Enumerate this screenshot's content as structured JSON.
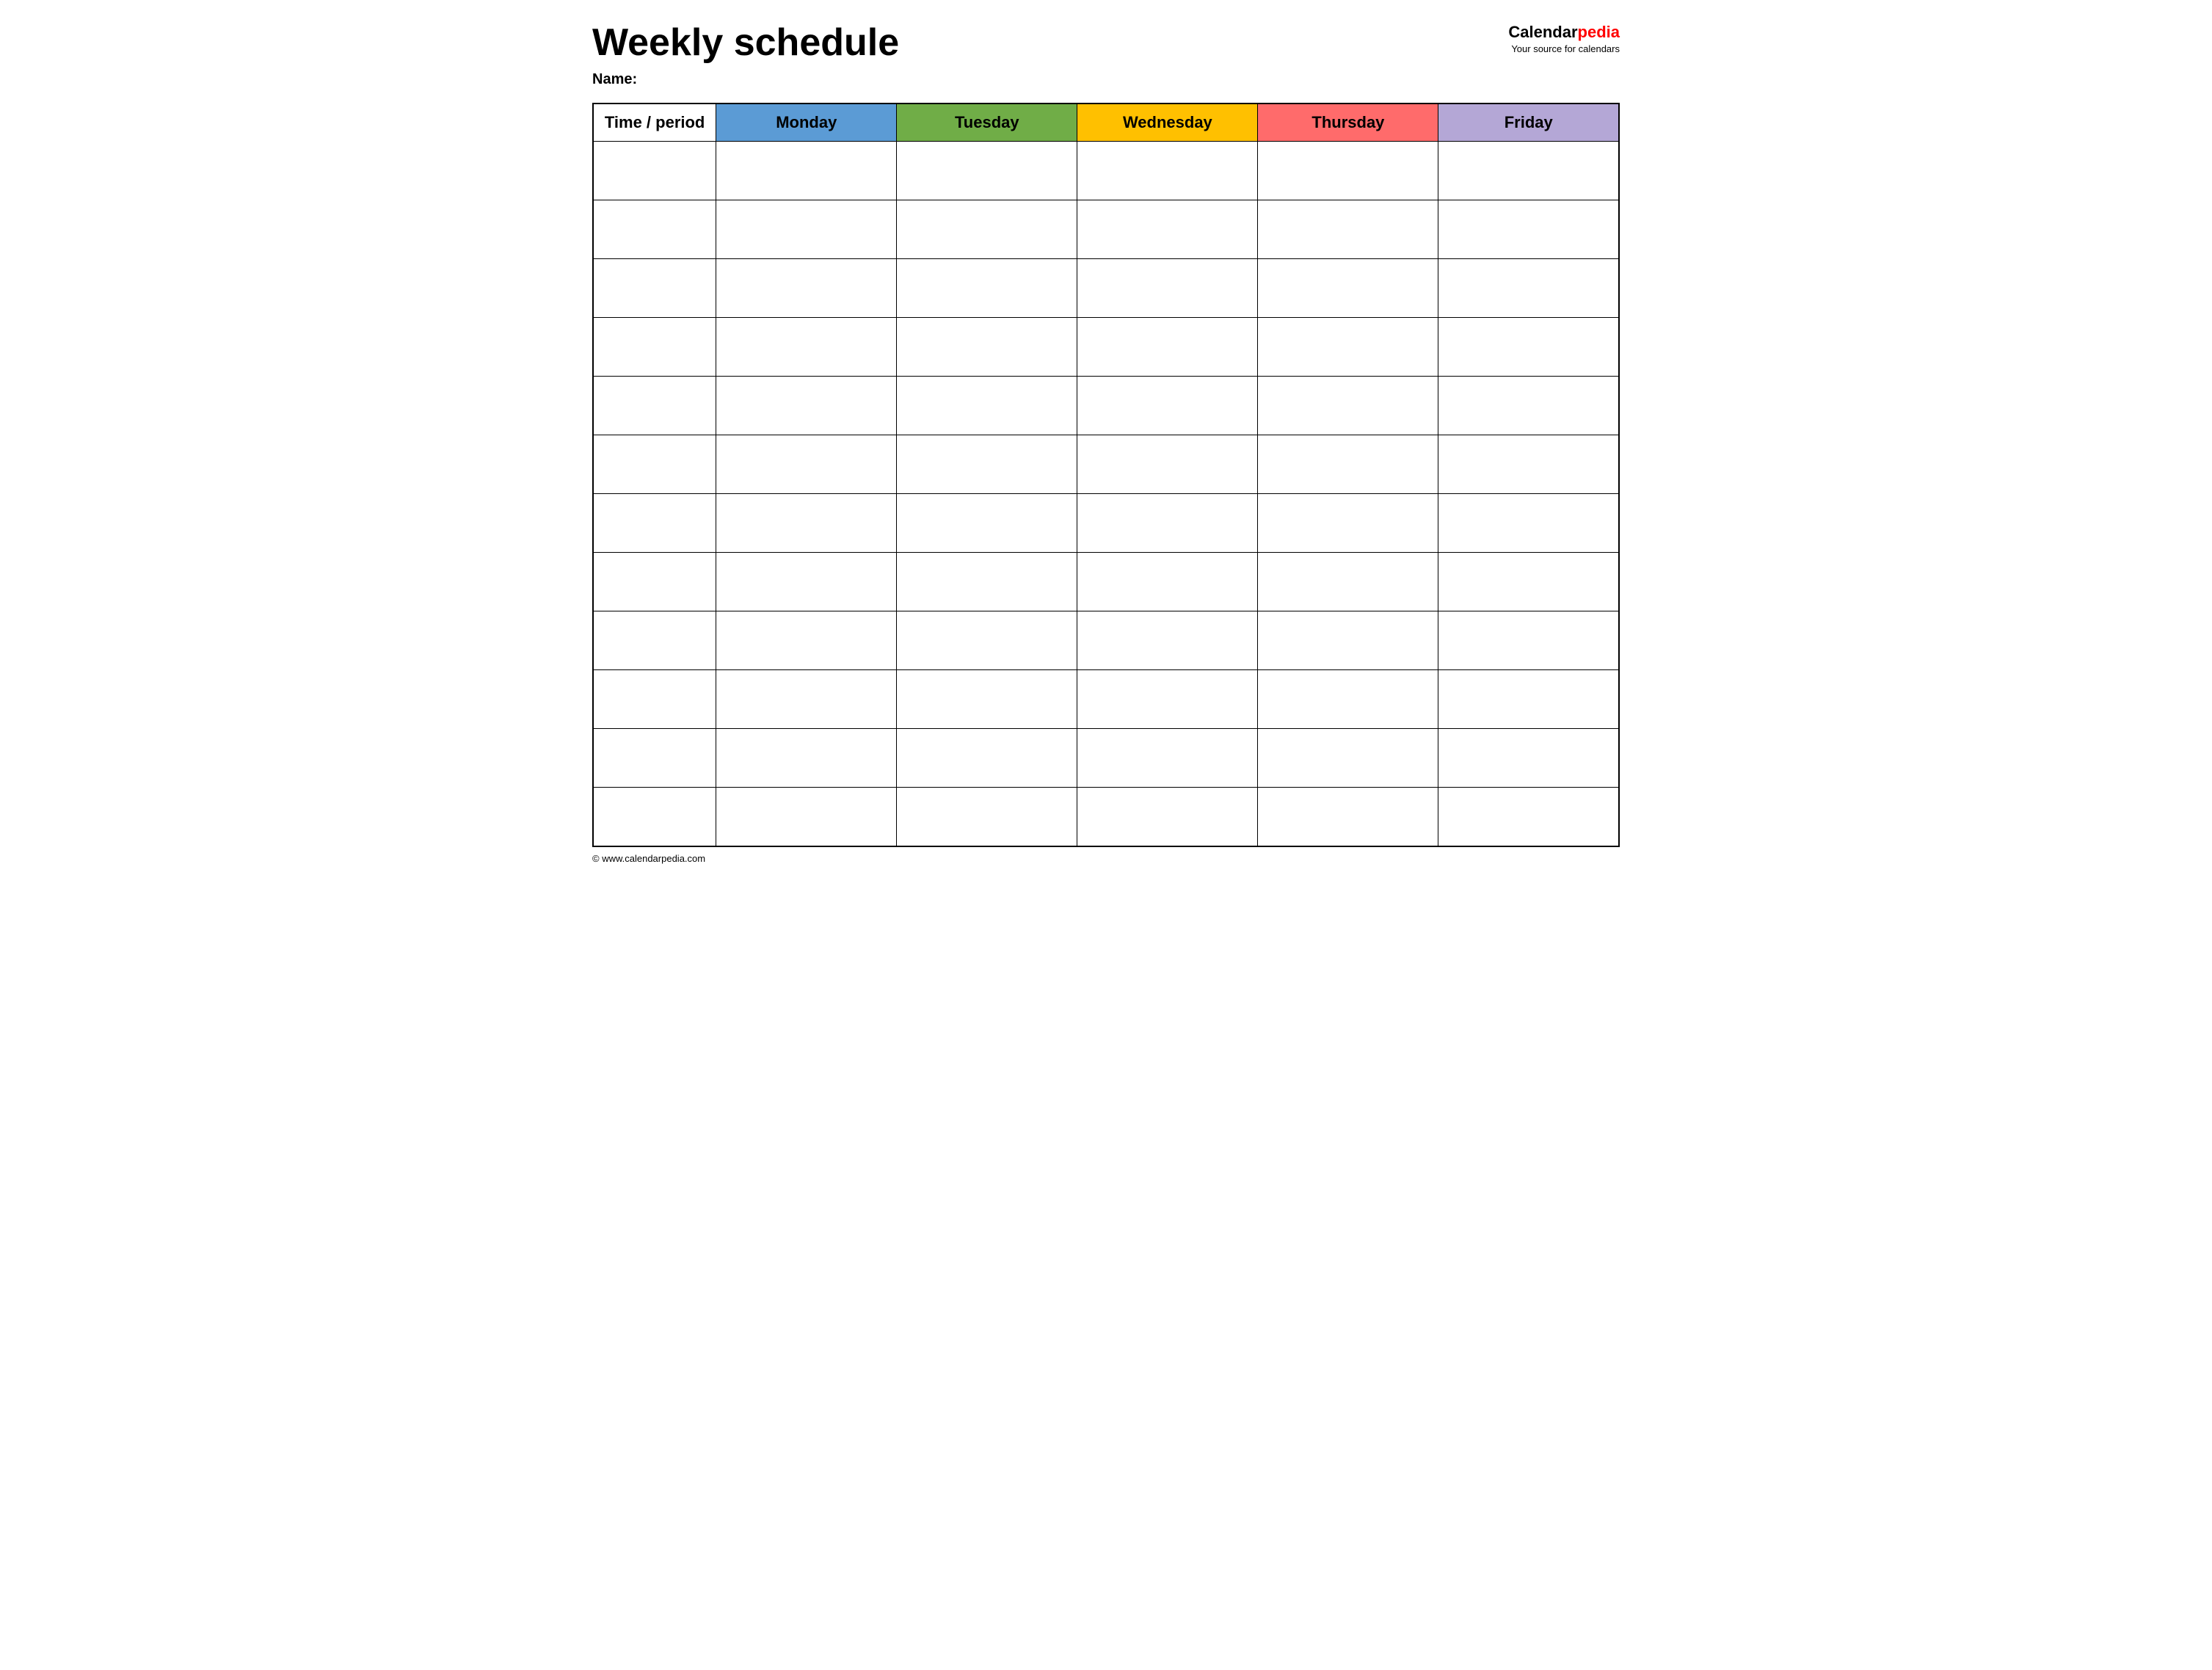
{
  "header": {
    "title": "Weekly schedule",
    "logo_calendar": "Calendar",
    "logo_pedia": "pedia",
    "logo_tagline": "Your source for calendars",
    "name_label": "Name:"
  },
  "table": {
    "columns": [
      {
        "key": "time",
        "label": "Time / period",
        "class": "th-time"
      },
      {
        "key": "monday",
        "label": "Monday",
        "class": "th-monday"
      },
      {
        "key": "tuesday",
        "label": "Tuesday",
        "class": "th-tuesday"
      },
      {
        "key": "wednesday",
        "label": "Wednesday",
        "class": "th-wednesday"
      },
      {
        "key": "thursday",
        "label": "Thursday",
        "class": "th-thursday"
      },
      {
        "key": "friday",
        "label": "Friday",
        "class": "th-friday"
      }
    ],
    "row_count": 12
  },
  "footer": {
    "url": "© www.calendarpedia.com"
  }
}
